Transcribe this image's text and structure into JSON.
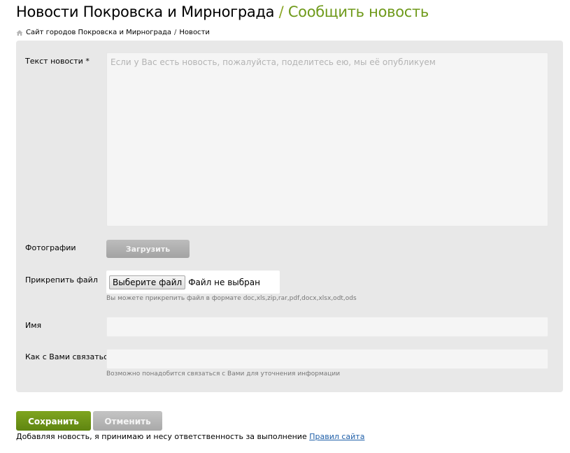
{
  "header": {
    "title_main": "Новости Покровска и Мирнограда",
    "title_separator": "/",
    "title_sub": "Сообщить новость"
  },
  "breadcrumb": {
    "home_icon": "home-icon",
    "site": "Сайт городов Покровска и Мирнограда",
    "separator": "/",
    "current": "Новости"
  },
  "form": {
    "news_text": {
      "label": "Текст новости *",
      "value": "",
      "placeholder": "Если у Вас есть новость, пожалуйста, поделитесь ею, мы её опубликуем"
    },
    "photos": {
      "label": "Фотографии",
      "button": "Загрузить"
    },
    "attach": {
      "label": "Прикрепить файл",
      "choose_button": "Выберите файл",
      "status": "Файл не выбран",
      "hint": "Вы можете прикрепить файл в формате doc,xls,zip,rar,pdf,docx,xlsx,odt,ods"
    },
    "name": {
      "label": "Имя",
      "value": ""
    },
    "contact": {
      "label": "Как с Вами связаться?",
      "value": "",
      "hint": "Возможно понадобится связаться с Вами для уточнения информации"
    }
  },
  "actions": {
    "save": "Сохранить",
    "cancel": "Отменить"
  },
  "footer": {
    "agreement_text": "Добавляя новость, я принимаю и несу ответственность за выполнение",
    "rules_link": "Правил сайта"
  },
  "colors": {
    "accent_green": "#6f9a1b",
    "save_button": "#6f9518",
    "panel_bg": "#e8e8e8",
    "link": "#1f5fa8"
  }
}
